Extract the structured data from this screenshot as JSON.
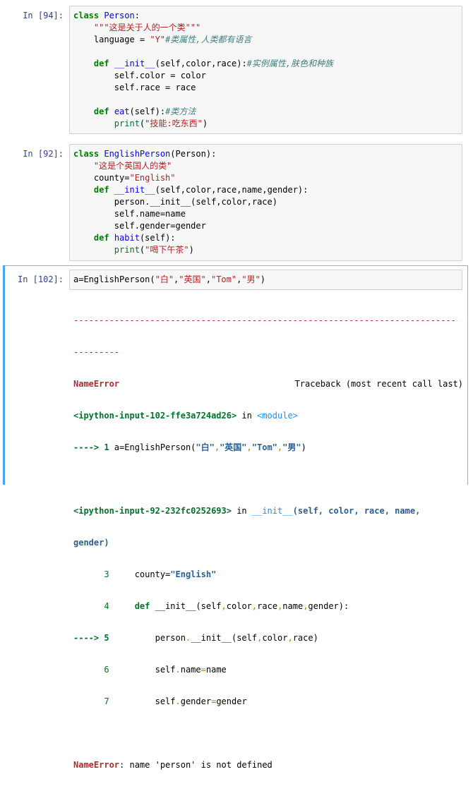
{
  "cells": [
    {
      "prompt": "In  [94]:",
      "lines": [
        [
          "class",
          " ",
          "Person",
          ":"
        ],
        [
          "    ",
          "\"\"\"这是关于人的一个类\"\"\""
        ],
        [
          "    language = ",
          "\"Y\"",
          "#类属性,人类都有语言"
        ],
        [
          ""
        ],
        [
          "    ",
          "def",
          " ",
          "__init__",
          "(self,color,race):",
          "#实例属性,肤色和种族"
        ],
        [
          "        self.color = color"
        ],
        [
          "        self.race = race"
        ],
        [
          ""
        ],
        [
          "    ",
          "def",
          " ",
          "eat",
          "(self):",
          "#类方法"
        ],
        [
          "        ",
          "print",
          "(",
          "\"技能:吃东西\"",
          ")"
        ]
      ]
    },
    {
      "prompt": "In  [92]:",
      "lines": [
        [
          "class",
          " ",
          "EnglishPerson",
          "(Person):"
        ],
        [
          "    ",
          "\"这是个英国人的类\""
        ],
        [
          "    county=",
          "\"English\""
        ],
        [
          "    ",
          "def",
          " ",
          "__init__",
          "(self,color,race,name,gender):"
        ],
        [
          "        person.__init__(self,color,race)"
        ],
        [
          "        self.name=name"
        ],
        [
          "        self.gender=gender"
        ],
        [
          "    ",
          "def",
          " ",
          "habit",
          "(self):"
        ],
        [
          "        ",
          "print",
          "(",
          "\"喝下午茶\"",
          ")"
        ]
      ]
    },
    {
      "prompt": "In  [102]:",
      "code": [
        "a=EnglishPerson(",
        "\"白\"",
        ",",
        "\"英国\"",
        ",",
        "\"Tom\"",
        ",",
        "\"男\"",
        ")"
      ]
    }
  ],
  "traceback": {
    "dashes1": "---------------------------------------------------------------------------",
    "dashes2": "---------",
    "error_name": "NameError",
    "header_right": "Traceback (most recent call last)",
    "frame1_file": "<ipython-input-102-ffe3a724ad26>",
    "frame1_in": " in ",
    "frame1_module": "<module>",
    "frame1_arrow": "----> 1 ",
    "frame1_code": [
      "a=EnglishPerson(",
      "\"白\"",
      ",",
      "\"英国\"",
      ",",
      "\"Tom\"",
      ",",
      "\"男\"",
      ")"
    ],
    "frame2_file": "<ipython-input-92-232fc0252693>",
    "frame2_in": " in ",
    "frame2_func": "__init__",
    "frame2_args": "(self, color, race, name,",
    "frame2_args2": "gender)",
    "frame2_lines": [
      {
        "no": "      3 ",
        "code": [
          "    county=",
          "\"English\""
        ]
      },
      {
        "no": "      4 ",
        "code": [
          "    ",
          "def",
          " __init__(self",
          ",",
          "color",
          ",",
          "race",
          ",",
          "name",
          ",",
          "gender):"
        ]
      },
      {
        "no": "----> 5 ",
        "code": [
          "        person",
          ".",
          "__init__(self",
          ",",
          "color",
          ",",
          "race)"
        ]
      },
      {
        "no": "      6 ",
        "code": [
          "        self",
          ".",
          "name",
          "=",
          "name"
        ]
      },
      {
        "no": "      7 ",
        "code": [
          "        self",
          ".",
          "gender",
          "=",
          "gender"
        ]
      }
    ],
    "final_error": "NameError",
    "final_msg": ": name 'person' is not defined"
  }
}
